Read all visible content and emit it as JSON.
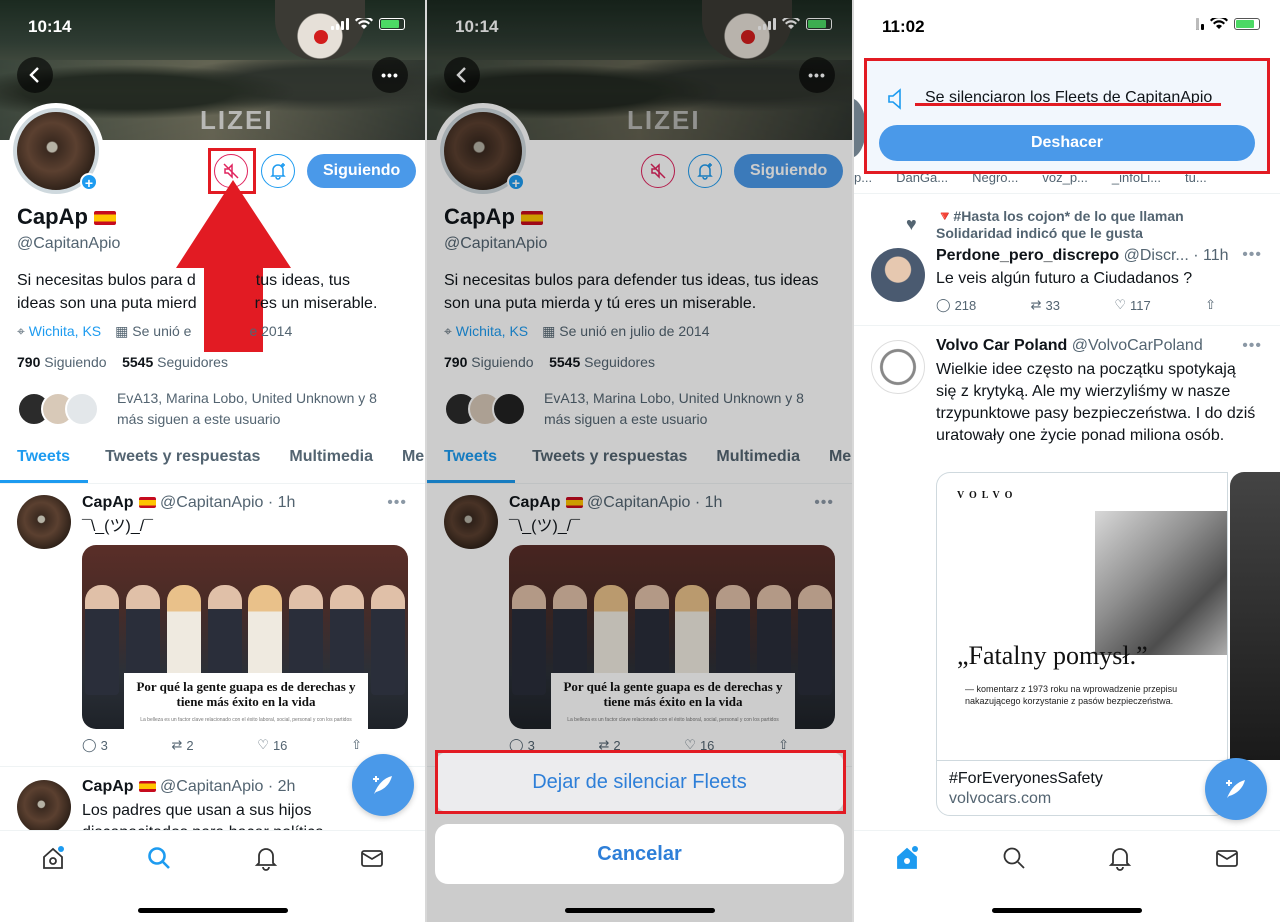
{
  "profile": {
    "name": "CapAp",
    "handle": "@CapitanApio",
    "bio": "Si necesitas bulos para defender tus ideas, tus ideas son una puta mierda y tú eres un miserable.",
    "location": "Wichita, KS",
    "joined": "Se unió en julio de 2014",
    "following_count": "790",
    "following_label": "Siguiendo",
    "followers_count": "5545",
    "followers_label": "Seguidores",
    "followed_by": "EvA13, Marina Lobo, United Unknown y 8 más siguen a este usuario",
    "follow_button": "Siguiendo",
    "banner_text": "LIZEI"
  },
  "tabs": [
    "Tweets",
    "Tweets y respuestas",
    "Multimedia",
    "Me"
  ],
  "panel1": {
    "time": "10:14",
    "bio_visible_a": "Si necesitas bulos para d",
    "bio_visible_b": "tus ideas, tus",
    "bio_visible_c": "ideas son una puta mierd",
    "bio_visible_d": "res un miserable.",
    "joined_visible_a": "Se unió e",
    "joined_visible_b": "e 2014"
  },
  "tweets": [
    {
      "name": "CapAp",
      "handle": "@CapitanApio",
      "time": "1h",
      "text": "¯\\_(ツ)_/¯",
      "image_caption": "Por qué la gente guapa es de derechas y tiene más éxito en la vida",
      "image_subcaption": "La belleza es un factor clave relacionado con el éxito laboral, social, personal y con los partidos conservadores",
      "replies": "3",
      "retweets": "2",
      "likes": "16"
    },
    {
      "name": "CapAp",
      "handle": "@CapitanApio",
      "time": "2h",
      "text": "Los padres que usan a sus hijos discapacitados para hacer política"
    }
  ],
  "panel2": {
    "time": "10:14",
    "unmute_action": "Dejar de silenciar Fleets",
    "cancel": "Cancelar"
  },
  "panel3": {
    "time": "11:02",
    "toast_message": "Se silenciaron los Fleets de CapitanApio",
    "undo_button": "Deshacer",
    "fleet_labels": [
      "p...",
      "DanGa...",
      "Negro...",
      "voz_p...",
      "_infoLi...",
      "tu..."
    ],
    "social_context_a": "🔻#Hasta los cojon* de lo que llaman",
    "social_context_b": "Solidaridad indicó que le gusta",
    "tweet1": {
      "name": "Perdone_pero_discrepo",
      "handle": "@Discr...",
      "time": "11h",
      "text": "Le veis algún futuro a Ciudadanos ?",
      "replies": "218",
      "retweets": "33",
      "likes": "117"
    },
    "tweet2": {
      "name": "Volvo Car Poland",
      "handle": "@VolvoCarPoland",
      "text": "Wielkie idee często na początku spotykają się z krytyką. Ale my wierzyliśmy w nasze trzypunktowe pasy bezpieczeństwa. I do dziś uratowały one życie ponad miliona osób.",
      "card_brand": "VOLVO",
      "card_quote": "„Fatalny pomysł.”",
      "card_sub": "— komentarz z 1973 roku na wprowadzenie przepisu nakazującego korzystanie z pasów bezpieczeństwa.",
      "card_hashtag": "#ForEveryonesSafety",
      "card_domain": "volvocars.com"
    }
  },
  "colors": {
    "accent": "#1d9bf0",
    "button": "#4a99e9",
    "mute": "#e0245e",
    "annotation_red": "#e21b23"
  },
  "icons": [
    "back-icon",
    "more-icon",
    "mute-icon",
    "bell-plus-icon",
    "location-icon",
    "calendar-icon",
    "reply-icon",
    "retweet-icon",
    "like-icon",
    "share-icon",
    "compose-icon",
    "home-icon",
    "search-icon",
    "notifications-icon",
    "messages-icon",
    "speaker-icon",
    "red-arrow"
  ]
}
